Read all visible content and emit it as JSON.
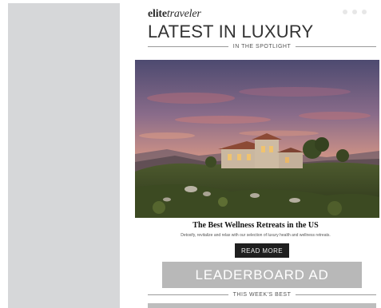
{
  "newsletter": {
    "logo": {
      "part1": "elite",
      "part2": "traveler"
    },
    "headline": "LATEST IN LUXURY",
    "spotlight_label": "IN THE SPOTLIGHT",
    "hero_image": "villa-sunset-hills-photo",
    "article": {
      "title": "The Best Wellness Retreats in the US",
      "description": "Detoxify, revitalize and relax with our selection of luxury health and wellness retreats."
    },
    "read_more_label": "READ MORE",
    "ad_label": "LEADERBOARD AD",
    "weekly_label": "THIS WEEK'S BEST"
  },
  "colors": {
    "left_panel": "#d6d7d9",
    "button": "#1f1f1f",
    "ad_background": "#b8b8b8",
    "text_dark": "#333333"
  }
}
